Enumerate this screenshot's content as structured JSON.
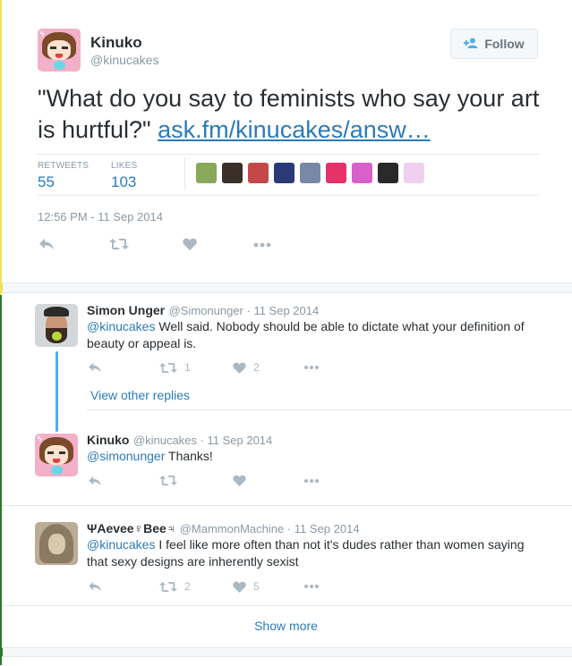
{
  "tweet": {
    "author_name": "Kinuko",
    "author_handle": "@kinucakes",
    "follow_label": "Follow",
    "text": "\"What do you say to feminists who say your art is hurtful?\" ",
    "link_text": "ask.fm/kinucakes/answ…",
    "retweets_label": "RETWEETS",
    "retweets_count": "55",
    "likes_label": "LIKES",
    "likes_count": "103",
    "timestamp": "12:56 PM - 11 Sep 2014",
    "liker_avatar_colors": [
      "#8aa85a",
      "#3a3028",
      "#c44848",
      "#2a3a78",
      "#7a88a8",
      "#e8306a",
      "#d860c8",
      "#2a2a2a",
      "#f0d0f0"
    ]
  },
  "replies": [
    {
      "name": "Simon Unger",
      "handle": "@Simonunger",
      "date": "11 Sep 2014",
      "mention": "@kinucakes",
      "text": " Well said. Nobody should be able to dictate what your definition of beauty or appeal is.",
      "retweets": "1",
      "likes": "2"
    },
    {
      "name": "Kinuko",
      "handle": "@kinucakes",
      "date": "11 Sep 2014",
      "mention": "@simonunger",
      "text": " Thanks!",
      "retweets": "",
      "likes": ""
    },
    {
      "name": "ΨAevee♀Bee♃",
      "handle": "@MammonMachine",
      "date": "11 Sep 2014",
      "mention": "@kinucakes",
      "text": " I feel like more often than not it's dudes rather than women saying that sexy designs are inherently sexist",
      "retweets": "2",
      "likes": "5"
    }
  ],
  "view_other_replies": "View other replies",
  "show_more": "Show more",
  "separator": " · ",
  "colors": {
    "link": "#2b7bb9",
    "accent": "#55acee",
    "muted": "#8899a6",
    "icon": "#aab8c2"
  }
}
